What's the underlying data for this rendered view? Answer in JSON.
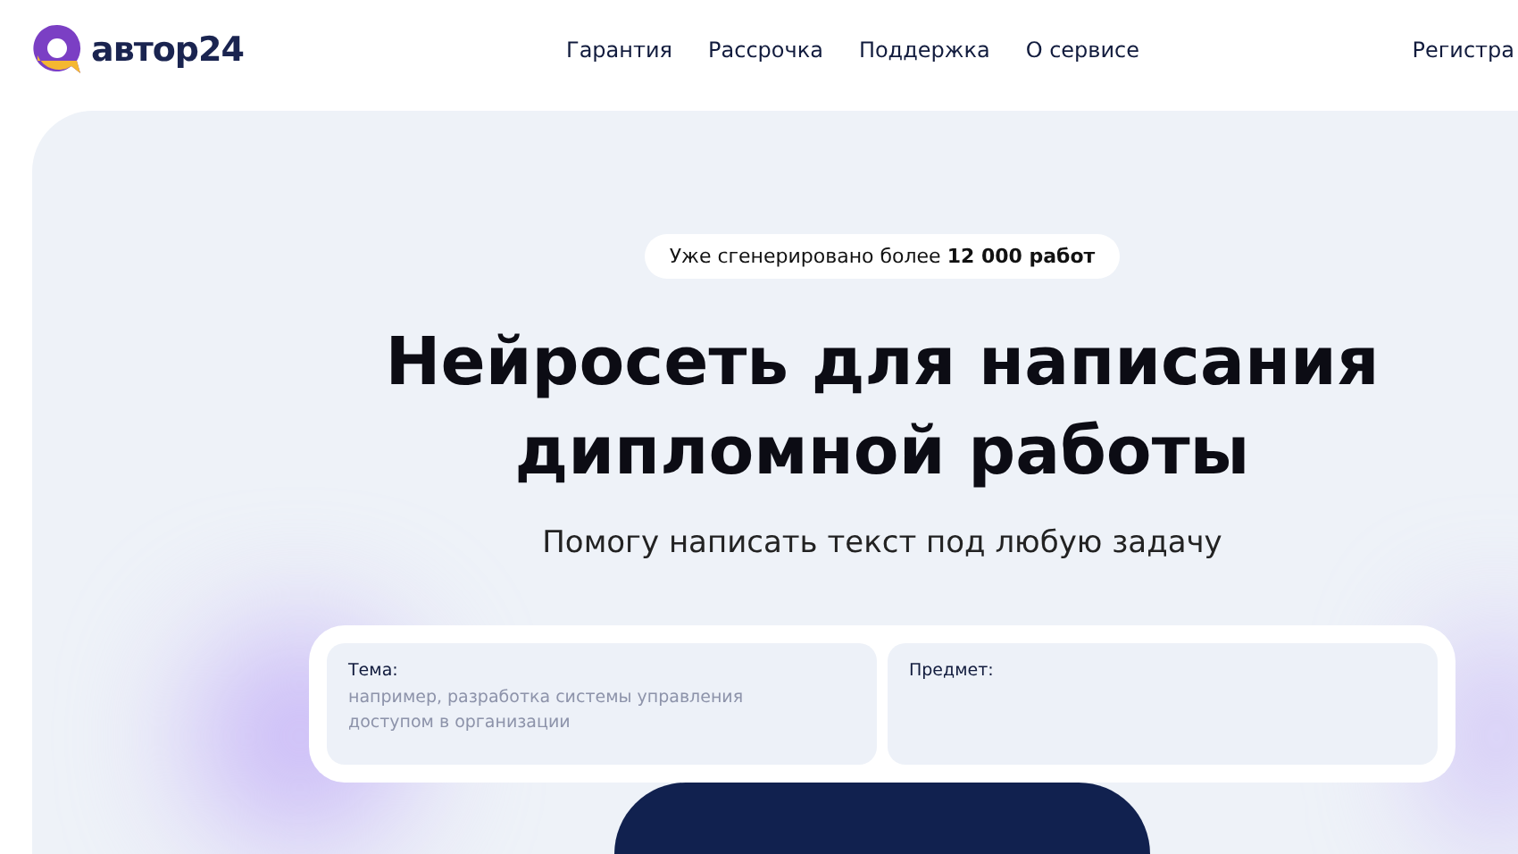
{
  "header": {
    "logo": "автор24",
    "nav": [
      "Гарантия",
      "Рассрочка",
      "Поддержка",
      "О сервисе"
    ],
    "register": "Регистра"
  },
  "hero": {
    "badge": "Уже сгенерировано более **12 000 работ**",
    "title": "Нейросеть для написания дипломной работы",
    "subtitle": "Помогу написать текст под любую задачу",
    "fields": [
      {
        "label": "Тема:",
        "placeholder": "например, разработка системы управления доступом в организации"
      },
      {
        "label": "Предмет:"
      }
    ]
  }
}
